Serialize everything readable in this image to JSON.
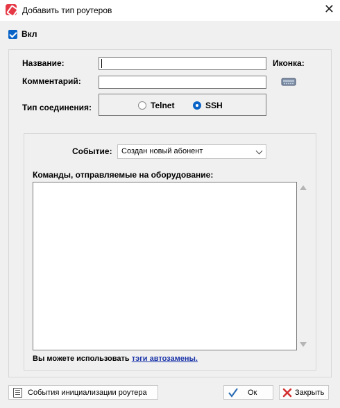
{
  "window": {
    "title": "Добавить тип роутеров",
    "close_glyph": "✕"
  },
  "enabled": {
    "label": "Вкл",
    "checked": true
  },
  "form": {
    "name_label": "Название:",
    "name_value": "",
    "comment_label": "Комментарий:",
    "comment_value": "",
    "icon_label": "Иконка:",
    "icon": "router-icon",
    "connection_label": "Тип соединения:",
    "connection_options": [
      "Telnet",
      "SSH"
    ],
    "connection_selected": "SSH"
  },
  "event": {
    "label": "Событие:",
    "selected": "Создан новый абонент"
  },
  "commands": {
    "label": "Команды, отправляемые на оборудование:",
    "value": ""
  },
  "hint": {
    "text": "Вы можете использовать ",
    "link": "тэги автозамены."
  },
  "buttons": {
    "init_events": "События инициализации роутера",
    "ok": "Ок",
    "close": "Закрыть"
  },
  "colors": {
    "accent": "#0a64c8",
    "link": "#1a33a8",
    "close_red": "#d32f2f",
    "ok_check": "#2e6fb5"
  }
}
